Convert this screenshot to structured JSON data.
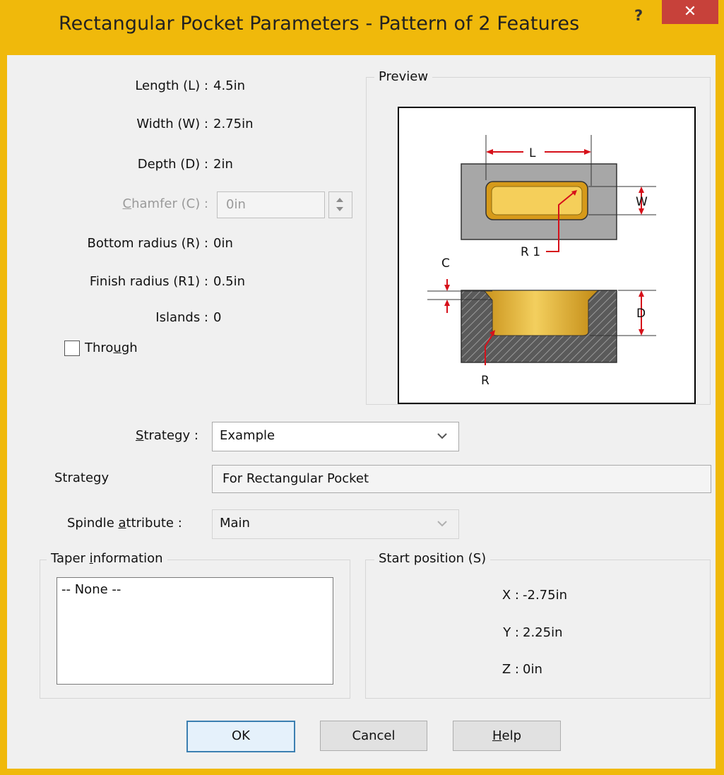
{
  "window": {
    "title": "Rectangular Pocket Parameters - Pattern of 2 Features",
    "help_glyph": "?",
    "close_glyph": "✕"
  },
  "params": {
    "length_label": "Length (L) :",
    "length_value": "4.5in",
    "width_label": "Width (W) :",
    "width_value": "2.75in",
    "depth_label": "Depth (D) :",
    "depth_value": "2in",
    "chamfer_label_first": "C",
    "chamfer_label_rest": "hamfer (C) :",
    "chamfer_value": "0in",
    "bottom_radius_label": "Bottom radius (R) :",
    "bottom_radius_value": "0in",
    "finish_radius_label": "Finish radius (R1) :",
    "finish_radius_value": "0.5in",
    "islands_label": "Islands :",
    "islands_value": "0",
    "through_label_pre": "Thro",
    "through_label_ul": "u",
    "through_label_post": "gh"
  },
  "preview": {
    "title": "Preview",
    "label_l": "L",
    "label_w": "W",
    "label_r1": "R 1",
    "label_c": "C",
    "label_d": "D",
    "label_r": "R"
  },
  "strategy": {
    "label_ul": "S",
    "label_rest": "trategy :",
    "selected": "Example",
    "desc_label": "Strategy",
    "desc_value": "For Rectangular Pocket"
  },
  "spindle": {
    "label_pre": "Spindle ",
    "label_ul": "a",
    "label_post": "ttribute :",
    "selected": "Main"
  },
  "taper": {
    "title_pre": "Taper ",
    "title_ul": "i",
    "title_post": "nformation",
    "items": [
      "-- None --"
    ]
  },
  "start_position": {
    "title": "Start position (S)",
    "x_label": "X :",
    "x_value": "-2.75in",
    "y_label": "Y :",
    "y_value": "2.25in",
    "z_label": "Z :",
    "z_value": "0in"
  },
  "buttons": {
    "ok": "OK",
    "cancel": "Cancel",
    "help_ul": "H",
    "help_rest": "elp"
  },
  "colors": {
    "frame": "#f0b90b",
    "close": "#c7413a",
    "pocket_gold": "#e8b52a",
    "dimension_red": "#d6101a"
  }
}
